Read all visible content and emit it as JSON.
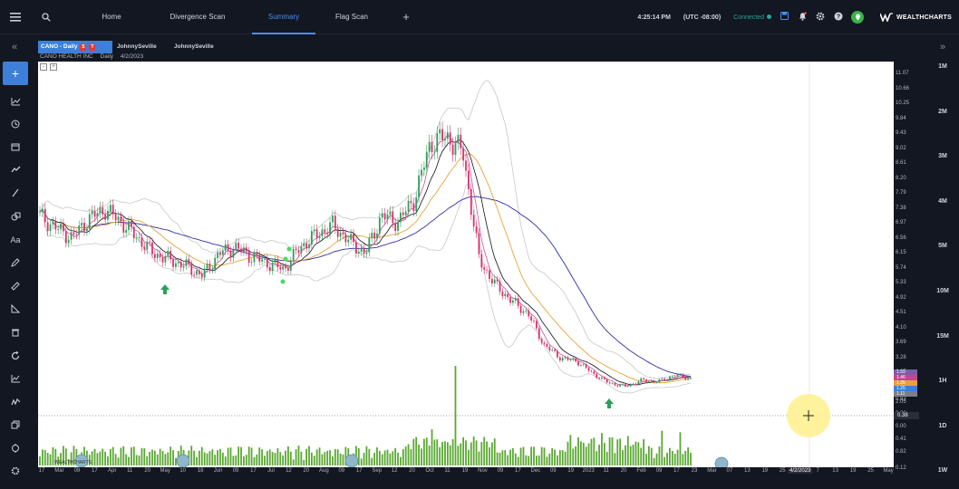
{
  "nav": {
    "tabs": [
      {
        "label": "Home"
      },
      {
        "label": "Divergence Scan"
      },
      {
        "label": "Summary",
        "active": true
      },
      {
        "label": "Flag Scan"
      }
    ],
    "add_label": "+",
    "clock": "4:25:14 PM",
    "timezone": "(UTC -08:00)",
    "connection": "Connected",
    "brand": "WEALTHCHARTS"
  },
  "chart_tabs": [
    {
      "label": "CANO - Daily",
      "badges": [
        "S",
        "T"
      ]
    },
    {
      "label": "JohnnySeville"
    },
    {
      "label": "JohnnySeville"
    }
  ],
  "symbol_info": {
    "name": "CANO HEALTH INC",
    "interval": "Daily",
    "date": "4/2/2023"
  },
  "timeframes": [
    "1M",
    "2M",
    "3M",
    "4M",
    "5M",
    "10M",
    "15M",
    "1H",
    "1D",
    "1W"
  ],
  "price_axis": {
    "labels": [
      "11.07",
      "10.66",
      "10.25",
      "9.84",
      "9.43",
      "9.02",
      "8.61",
      "8.20",
      "7.79",
      "7.38",
      "6.97",
      "6.56",
      "6.15",
      "5.74",
      "5.33",
      "4.92",
      "4.51",
      "4.10",
      "3.69",
      "3.28",
      "2.87",
      "2.46",
      "2.05",
      "0.82",
      "0.38",
      "0.00",
      "0.41",
      "0.82",
      "0.12"
    ],
    "tags": [
      "1.59",
      "1.46",
      "1.35",
      "1.25",
      "1.11"
    ]
  },
  "time_axis": {
    "labels": [
      "17",
      "Mar",
      "09",
      "17",
      "Apr",
      "11",
      "20",
      "May",
      "10",
      "18",
      "Jun",
      "09",
      "17",
      "Jul",
      "12",
      "20",
      "Aug",
      "09",
      "17",
      "Sep",
      "12",
      "20",
      "Oct",
      "11",
      "19",
      "Nov",
      "09",
      "17",
      "Dec",
      "09",
      "19",
      "2023",
      "11",
      "20",
      "Feb",
      "09",
      "17",
      "23",
      "Mar",
      "07",
      "13",
      "19",
      "25",
      "4/2/2023",
      "7",
      "13",
      "19",
      "25",
      "May"
    ],
    "crosshair_label": "4/2/2023"
  },
  "chart_data": {
    "type": "candlestick",
    "symbol": "CANO",
    "y_range": [
      0.82,
      11.07
    ],
    "close_series": [
      {
        "x": "Feb 17",
        "y": 6.6
      },
      {
        "x": "Feb 24",
        "y": 6.2
      },
      {
        "x": "Mar 01",
        "y": 5.9
      },
      {
        "x": "Mar 09",
        "y": 6.5
      },
      {
        "x": "Mar 17",
        "y": 6.8
      },
      {
        "x": "Mar 24",
        "y": 6.4
      },
      {
        "x": "Apr 01",
        "y": 5.9
      },
      {
        "x": "Apr 11",
        "y": 5.4
      },
      {
        "x": "Apr 20",
        "y": 5.2
      },
      {
        "x": "May 01",
        "y": 5.0
      },
      {
        "x": "May 10",
        "y": 4.7
      },
      {
        "x": "May 18",
        "y": 5.4
      },
      {
        "x": "Jun 01",
        "y": 5.6
      },
      {
        "x": "Jun 09",
        "y": 5.3
      },
      {
        "x": "Jun 17",
        "y": 5.1
      },
      {
        "x": "Jul 01",
        "y": 4.9
      },
      {
        "x": "Jul 12",
        "y": 5.6
      },
      {
        "x": "Jul 20",
        "y": 6.0
      },
      {
        "x": "Aug 01",
        "y": 6.3
      },
      {
        "x": "Aug 09",
        "y": 5.8
      },
      {
        "x": "Aug 17",
        "y": 5.4
      },
      {
        "x": "Sep 01",
        "y": 6.6
      },
      {
        "x": "Sep 12",
        "y": 6.4
      },
      {
        "x": "Sep 20",
        "y": 7.1
      },
      {
        "x": "Sep 28",
        "y": 8.9
      },
      {
        "x": "Oct 05",
        "y": 9.1
      },
      {
        "x": "Oct 11",
        "y": 8.6
      },
      {
        "x": "Oct 19",
        "y": 5.2
      },
      {
        "x": "Oct 26",
        "y": 4.4
      },
      {
        "x": "Nov 01",
        "y": 3.9
      },
      {
        "x": "Nov 09",
        "y": 3.5
      },
      {
        "x": "Nov 17",
        "y": 2.5
      },
      {
        "x": "Nov 28",
        "y": 2.1
      },
      {
        "x": "Dec 09",
        "y": 2.0
      },
      {
        "x": "Dec 19",
        "y": 1.6
      },
      {
        "x": "Dec 28",
        "y": 1.3
      },
      {
        "x": "Jan 11",
        "y": 1.2
      },
      {
        "x": "Jan 20",
        "y": 1.4
      },
      {
        "x": "Feb 01",
        "y": 1.35
      },
      {
        "x": "Feb 09",
        "y": 1.55
      },
      {
        "x": "Feb 17",
        "y": 1.45
      }
    ],
    "indicators": [
      "Bollinger Bands",
      "Moving Averages",
      "Volume"
    ]
  }
}
